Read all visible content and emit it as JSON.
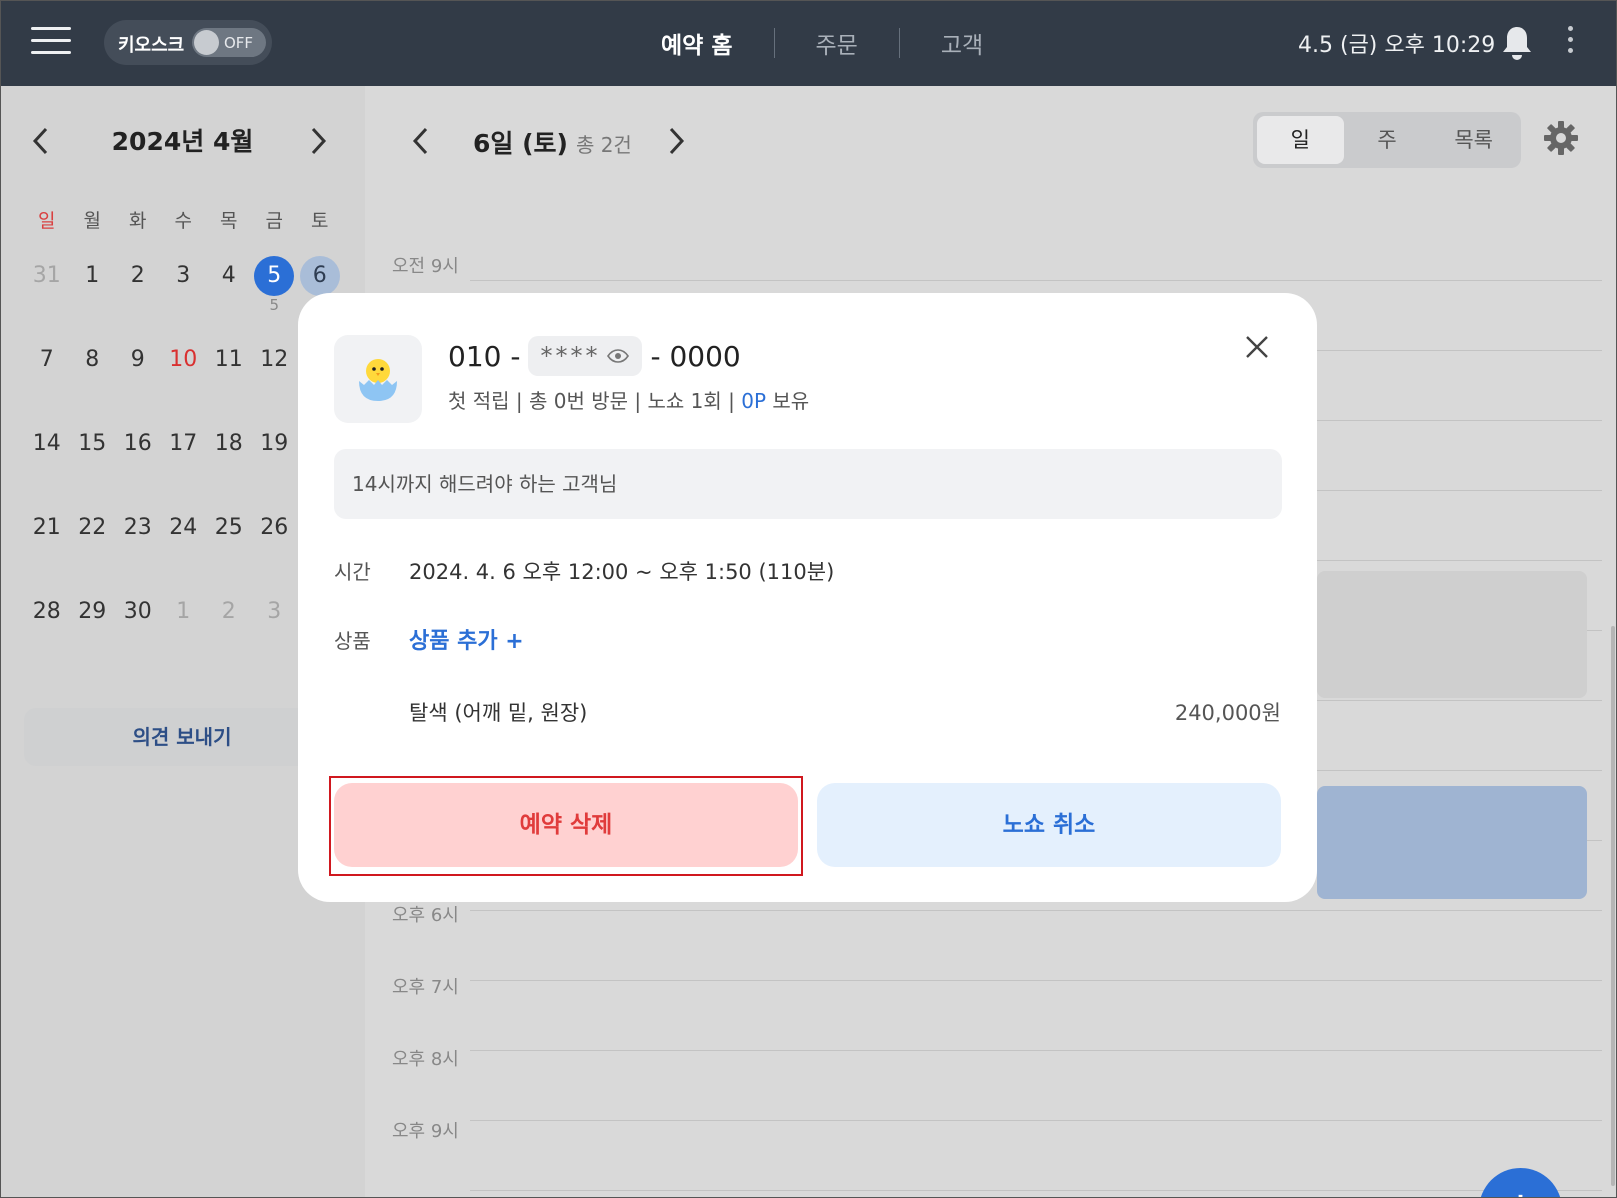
{
  "topbar": {
    "menu_icon": "hamburger-menu-icon",
    "kiosk_label": "키오스크",
    "kiosk_state": "OFF",
    "tabs": [
      {
        "label": "예약 홈",
        "active": true
      },
      {
        "label": "주문",
        "active": false
      },
      {
        "label": "고객",
        "active": false
      }
    ],
    "datetime": "4.5 (금) 오후 10:29",
    "bell_icon": "bell-icon",
    "more_icon": "more-vertical-icon"
  },
  "calendar": {
    "title": "2024년 4월",
    "weekdays": [
      "일",
      "월",
      "화",
      "수",
      "목",
      "금",
      "토"
    ],
    "weeks": [
      [
        {
          "d": "31",
          "s": "muted"
        },
        {
          "d": "1"
        },
        {
          "d": "2"
        },
        {
          "d": "3"
        },
        {
          "d": "4"
        },
        {
          "d": "5",
          "s": "today",
          "count": "5"
        },
        {
          "d": "6",
          "s": "selected"
        }
      ],
      [
        {
          "d": "7"
        },
        {
          "d": "8"
        },
        {
          "d": "9"
        },
        {
          "d": "10",
          "s": "red"
        },
        {
          "d": "11"
        },
        {
          "d": "12"
        },
        {
          "d": ""
        }
      ],
      [
        {
          "d": "14"
        },
        {
          "d": "15"
        },
        {
          "d": "16"
        },
        {
          "d": "17"
        },
        {
          "d": "18"
        },
        {
          "d": "19"
        },
        {
          "d": ""
        }
      ],
      [
        {
          "d": "21"
        },
        {
          "d": "22"
        },
        {
          "d": "23"
        },
        {
          "d": "24"
        },
        {
          "d": "25"
        },
        {
          "d": "26"
        },
        {
          "d": ""
        }
      ],
      [
        {
          "d": "28"
        },
        {
          "d": "29"
        },
        {
          "d": "30"
        },
        {
          "d": "1",
          "s": "muted"
        },
        {
          "d": "2",
          "s": "muted"
        },
        {
          "d": "3",
          "s": "muted"
        },
        {
          "d": ""
        }
      ]
    ],
    "feedback_label": "의견 보내기"
  },
  "day_view": {
    "title": "6일 (토)",
    "total": "총 2건",
    "views": [
      {
        "label": "일",
        "active": true
      },
      {
        "label": "주",
        "active": false
      },
      {
        "label": "목록",
        "active": false
      }
    ],
    "settings_icon": "gear-icon",
    "hours_top": [
      {
        "label": "오전 9시"
      }
    ],
    "hours_bottom": [
      {
        "label": "오후 6시"
      },
      {
        "label": "오후 7시"
      },
      {
        "label": "오후 8시"
      },
      {
        "label": "오후 9시"
      }
    ],
    "fab_label": "+"
  },
  "modal": {
    "avatar_icon": "chick-egg-icon",
    "phone_prefix": "010 -",
    "phone_masked": "****",
    "phone_suffix": "- 0000",
    "info_text": "첫 적립 | 총 0번 방문 | 노쇼 1회 | ",
    "points": "0P",
    "points_suffix": " 보유",
    "memo": "14시까지 해드려야 하는 고객님",
    "time_label": "시간",
    "time_value": "2024. 4. 6 오후 12:00 ~ 오후 1:50 (110분)",
    "product_label": "상품",
    "add_product": "상품 추가 +",
    "service_name": "탈색 (어깨 밑, 원장)",
    "service_price": "240,000원",
    "delete_button": "예약 삭제",
    "noshow_button": "노쇼 취소"
  },
  "colors": {
    "topbar": "#323b47",
    "accent": "#2b6fd6",
    "danger": "#e03b3b",
    "danger_bg": "#ffd1d1",
    "info_bg": "#e4f0fd",
    "highlight": "#d0181f"
  }
}
